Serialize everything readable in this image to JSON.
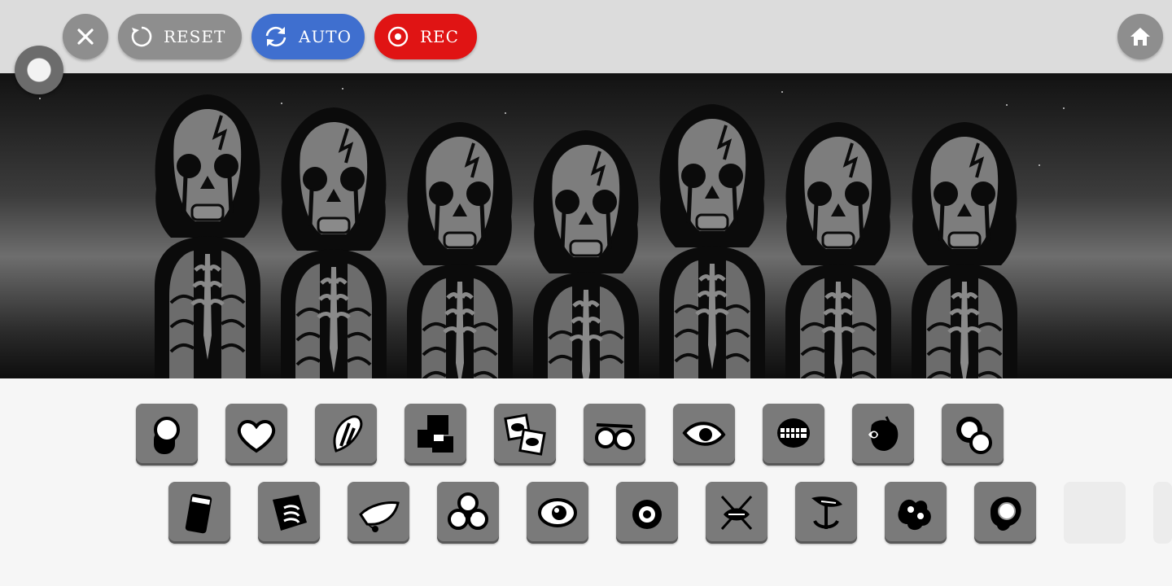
{
  "topbar": {
    "close_icon": "close-icon",
    "reset_label": "RESET",
    "auto_label": "AUTO",
    "rec_label": "REC",
    "home_icon": "home-icon",
    "colors": {
      "bar": "#dcdcdc",
      "gray_button": "#8e8e8e",
      "auto": "#3f6fcf",
      "rec": "#e01414"
    }
  },
  "stage": {
    "characters": [
      "character-1",
      "character-2",
      "character-3",
      "character-4",
      "character-5",
      "character-6",
      "character-7"
    ]
  },
  "tray": {
    "row1": [
      "beat-dot-icon",
      "heart-icon",
      "claw-mark-icon",
      "blocks-icon",
      "eyes-card-icon",
      "glasses-icon",
      "eye-icon",
      "jaw-teeth-icon",
      "apple-core-icon",
      "bubbles-icon"
    ],
    "row2": [
      "phone-icon",
      "stack-icon",
      "leaf-drop-icon",
      "clover-icon",
      "big-eye-icon",
      "ring-icon",
      "lips-cross-icon",
      "anchor-icon",
      "splats-icon",
      "blob-ring-icon",
      "empty-slot",
      "empty-slot"
    ]
  }
}
